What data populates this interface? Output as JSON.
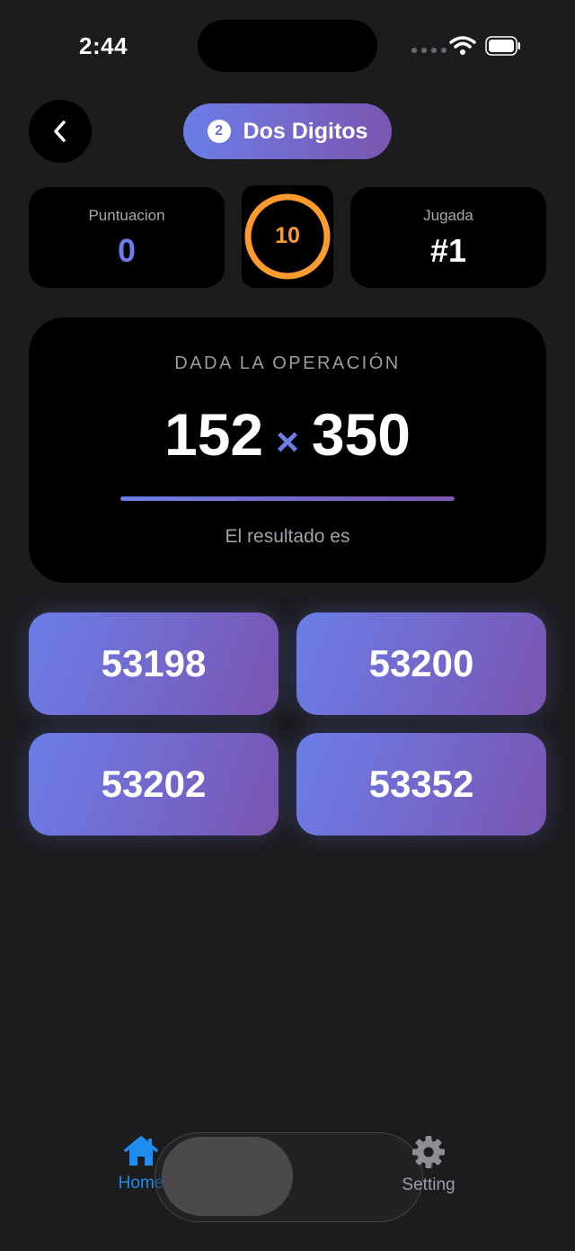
{
  "status_bar": {
    "time": "2:44"
  },
  "header": {
    "level_badge": "2",
    "level_title": "Dos Digitos"
  },
  "stats": {
    "score_label": "Puntuacion",
    "score_value": "0",
    "timer_value": "10",
    "round_label": "Jugada",
    "round_value": "#1"
  },
  "operation": {
    "title": "DADA LA OPERACIÓN",
    "left_operand": "152",
    "operator": "×",
    "right_operand": "350",
    "subtitle": "El resultado es"
  },
  "answers": [
    "53198",
    "53200",
    "53202",
    "53352"
  ],
  "tab_bar": {
    "home_label": "Home",
    "settings_label": "Setting"
  },
  "colors": {
    "background": "#1c1c1e",
    "accent_gradient_start": "#6b7ee8",
    "accent_gradient_end": "#7c55b0",
    "timer": "#ff9a2e",
    "tab_active": "#1f8cf0"
  }
}
